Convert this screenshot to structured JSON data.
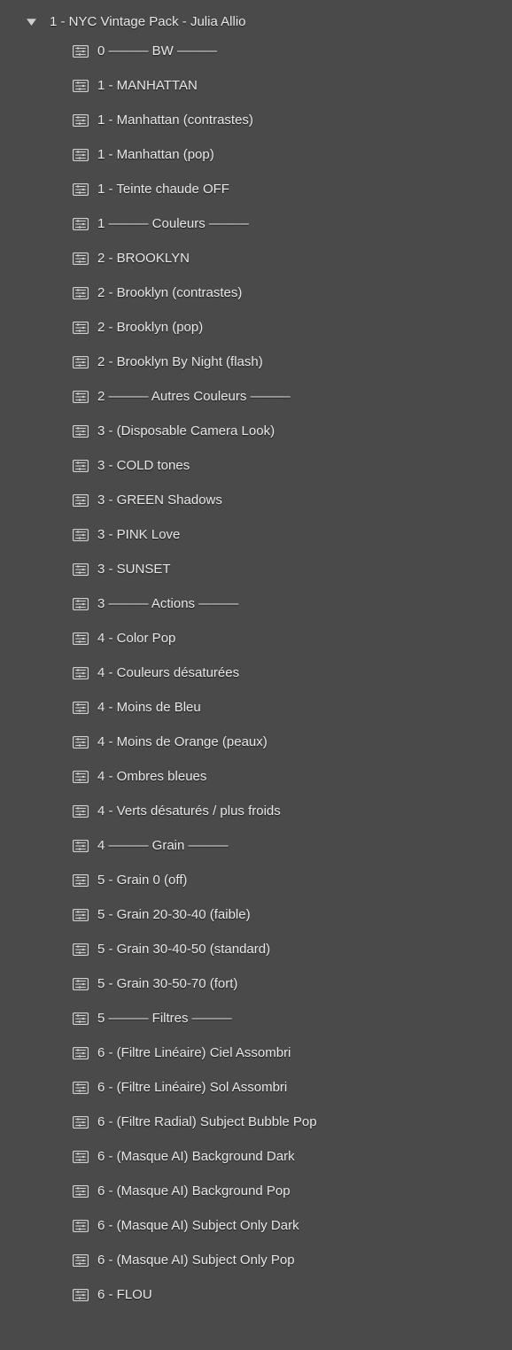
{
  "folder": {
    "name": "1 - NYC Vintage Pack - Julia Allio",
    "expanded": true
  },
  "presets": [
    {
      "label": "0 ——— BW ———"
    },
    {
      "label": "1 - MANHATTAN"
    },
    {
      "label": "1 - Manhattan (contrastes)"
    },
    {
      "label": "1 - Manhattan (pop)"
    },
    {
      "label": "1 - Teinte chaude OFF"
    },
    {
      "label": "1 ——— Couleurs ———"
    },
    {
      "label": "2 - BROOKLYN"
    },
    {
      "label": "2 - Brooklyn (contrastes)"
    },
    {
      "label": "2 - Brooklyn (pop)"
    },
    {
      "label": "2 - Brooklyn By Night (flash)"
    },
    {
      "label": "2 ——— Autres Couleurs ———"
    },
    {
      "label": "3 - (Disposable Camera Look)"
    },
    {
      "label": "3 - COLD tones"
    },
    {
      "label": "3 - GREEN Shadows"
    },
    {
      "label": "3 - PINK Love"
    },
    {
      "label": "3 - SUNSET"
    },
    {
      "label": "3 ——— Actions ———"
    },
    {
      "label": "4 - Color Pop"
    },
    {
      "label": "4 - Couleurs désaturées"
    },
    {
      "label": "4 - Moins de Bleu"
    },
    {
      "label": "4 - Moins de Orange (peaux)"
    },
    {
      "label": "4 - Ombres bleues"
    },
    {
      "label": "4 - Verts désaturés / plus froids"
    },
    {
      "label": "4 ——— Grain ———"
    },
    {
      "label": "5 - Grain 0 (off)"
    },
    {
      "label": "5 - Grain 20-30-40 (faible)"
    },
    {
      "label": "5 - Grain 30-40-50 (standard)"
    },
    {
      "label": "5 - Grain 30-50-70 (fort)"
    },
    {
      "label": "5 ——— Filtres ———"
    },
    {
      "label": "6 - (Filtre Linéaire) Ciel Assombri"
    },
    {
      "label": "6 - (Filtre Linéaire) Sol Assombri"
    },
    {
      "label": "6 - (Filtre Radial) Subject Bubble Pop"
    },
    {
      "label": "6 - (Masque AI) Background Dark"
    },
    {
      "label": "6 - (Masque AI) Background Pop"
    },
    {
      "label": "6 - (Masque AI) Subject Only Dark"
    },
    {
      "label": "6 - (Masque AI) Subject Only Pop"
    },
    {
      "label": "6 - FLOU"
    }
  ]
}
